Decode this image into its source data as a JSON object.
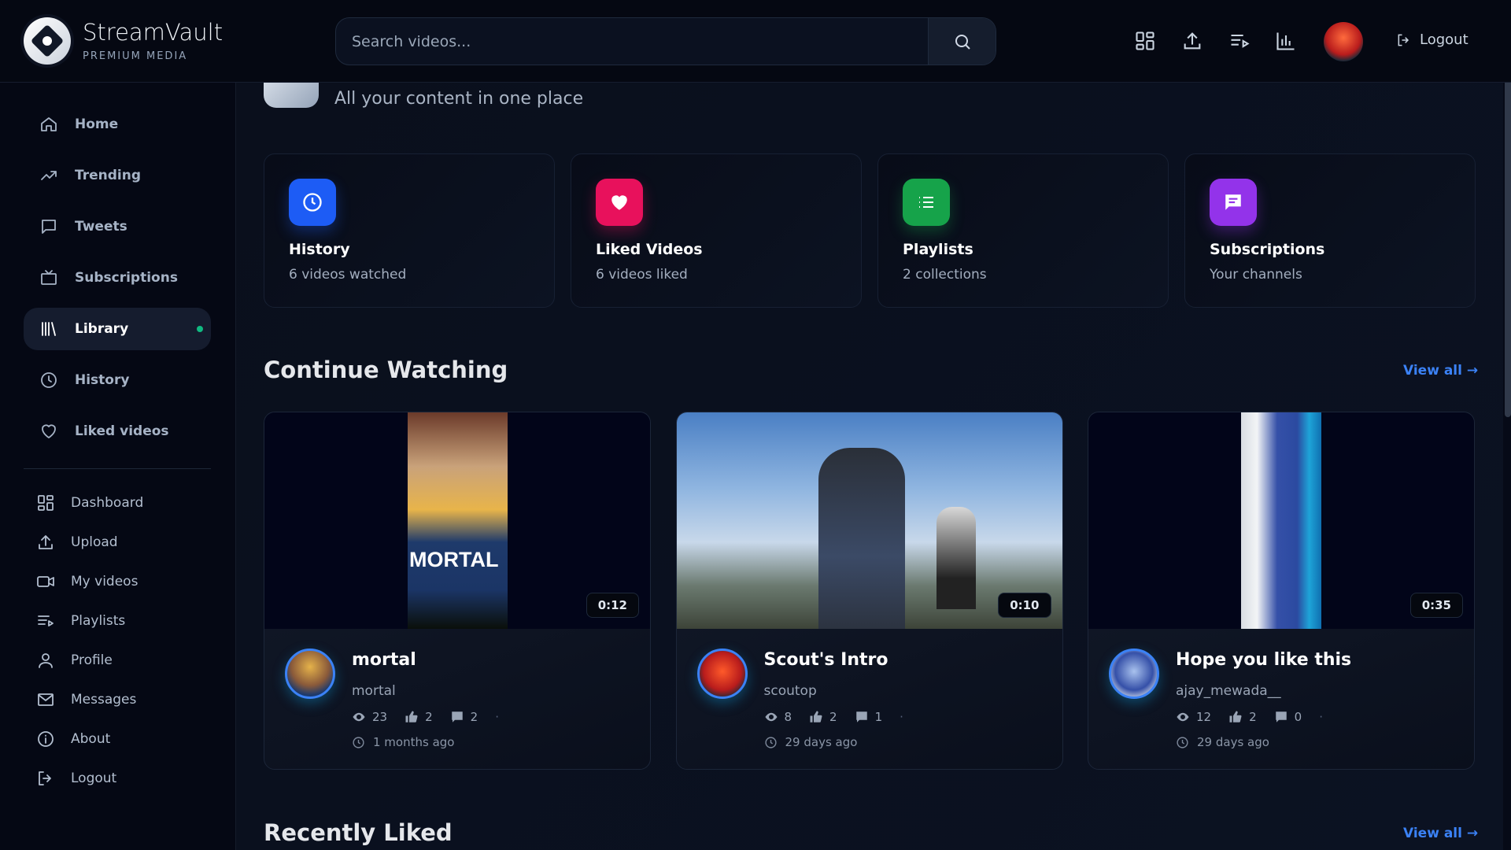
{
  "header": {
    "brand": "StreamVault",
    "brand_sub": "PREMIUM MEDIA",
    "search_placeholder": "Search videos...",
    "logout_label": "Logout",
    "icons": [
      "dashboard-icon",
      "upload-icon",
      "playlist-icon",
      "stats-icon"
    ]
  },
  "sidebar": {
    "primary": [
      {
        "label": "Home",
        "icon": "home-icon"
      },
      {
        "label": "Trending",
        "icon": "trending-icon"
      },
      {
        "label": "Tweets",
        "icon": "tweet-icon"
      },
      {
        "label": "Subscriptions",
        "icon": "subscriptions-icon"
      },
      {
        "label": "Library",
        "icon": "library-icon",
        "active": true
      },
      {
        "label": "History",
        "icon": "history-icon"
      },
      {
        "label": "Liked videos",
        "icon": "heart-icon"
      }
    ],
    "secondary": [
      {
        "label": "Dashboard",
        "icon": "dashboard-icon"
      },
      {
        "label": "Upload",
        "icon": "upload-icon"
      },
      {
        "label": "My videos",
        "icon": "video-icon"
      },
      {
        "label": "Playlists",
        "icon": "playlist-icon"
      },
      {
        "label": "Profile",
        "icon": "user-icon"
      },
      {
        "label": "Messages",
        "icon": "mail-icon"
      },
      {
        "label": "About",
        "icon": "info-icon"
      },
      {
        "label": "Logout",
        "icon": "logout-icon"
      }
    ],
    "active_indicator_color": "#10b981"
  },
  "page": {
    "subtitle": "All your content in one place"
  },
  "stats": [
    {
      "title": "History",
      "sub": "6 videos watched",
      "color": "#1d5cf5",
      "icon": "clock-icon"
    },
    {
      "title": "Liked Videos",
      "sub": "6 videos liked",
      "color": "#e8115c",
      "icon": "heart-icon"
    },
    {
      "title": "Playlists",
      "sub": "2 collections",
      "color": "#16a34a",
      "icon": "list-icon"
    },
    {
      "title": "Subscriptions",
      "sub": "Your channels",
      "color": "#9333ea",
      "icon": "chat-icon"
    }
  ],
  "continue_watching": {
    "title": "Continue Watching",
    "view_all": "View all",
    "videos": [
      {
        "title": "mortal",
        "channel": "mortal",
        "duration": "0:12",
        "views": "23",
        "likes": "2",
        "comments": "2",
        "time": "1 months ago"
      },
      {
        "title": "Scout's Intro",
        "channel": "scoutop",
        "duration": "0:10",
        "views": "8",
        "likes": "2",
        "comments": "1",
        "time": "29 days ago"
      },
      {
        "title": "Hope you like this",
        "channel": "ajay_mewada__",
        "duration": "0:35",
        "views": "12",
        "likes": "2",
        "comments": "0",
        "time": "29 days ago"
      }
    ]
  },
  "recently_liked": {
    "title": "Recently Liked",
    "view_all": "View all"
  },
  "colors": {
    "accent": "#3b82f6",
    "background": "#060a17"
  }
}
